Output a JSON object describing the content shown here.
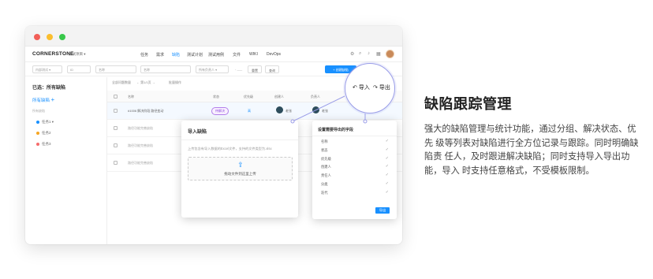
{
  "window": {
    "traffic_lights": [
      "#f25f58",
      "#fbbe2e",
      "#38c84a"
    ]
  },
  "topnav": {
    "brand": "CORNERSTONE",
    "project": "测试项目 ▾",
    "items": [
      {
        "label": "任务",
        "active": false
      },
      {
        "label": "需求",
        "active": false
      },
      {
        "label": "缺陷",
        "active": true
      },
      {
        "label": "测试计划",
        "active": false
      },
      {
        "label": "测试用例",
        "active": false
      },
      {
        "label": "文件",
        "active": false
      },
      {
        "label": "WIKI",
        "active": false
      },
      {
        "label": "DevOps",
        "active": false
      }
    ],
    "icons": [
      "settings-icon",
      "search-icon",
      "bell-icon",
      "grid-icon"
    ]
  },
  "filters": {
    "select1": "内部测试 ▾",
    "input1": "ID",
    "input2": "名称",
    "input3": "名称",
    "select2": "所有负责人 ▾",
    "date": "- ___",
    "reset": "重置",
    "search": "查询",
    "create": "+ 创建缺陷"
  },
  "sidebar": {
    "title": "已选：所有缺陷",
    "link": "所有缺陷",
    "subtitle": "所有缺陷",
    "items": [
      {
        "label": "任务1",
        "color": "#1890ff"
      },
      {
        "label": "任务2",
        "color": "#f5a623"
      },
      {
        "label": "任务3",
        "color": "#f56c6c"
      }
    ]
  },
  "main": {
    "tab_left": "全部问题数量",
    "tab_mid": "← 第1/1页 →",
    "tab_right": "批量操作",
    "columns": [
      "名称",
      "状态",
      "优先级",
      "创建人",
      "负责人"
    ],
    "rows": [
      {
        "name": "#1006 解决阶段 路径变动",
        "status": "待解决",
        "priority": "高",
        "creator": "老张",
        "owner": "老张"
      },
      {
        "name": "路径功能完善缺陷",
        "status": "",
        "priority": "",
        "creator": "",
        "owner": ""
      },
      {
        "name": "路径功能完善缺陷",
        "status": "",
        "priority": "",
        "creator": "",
        "owner": ""
      },
      {
        "name": "路径功能完善缺陷",
        "status": "",
        "priority": "",
        "creator": "",
        "owner": ""
      }
    ]
  },
  "import_modal": {
    "title": "导入缺陷",
    "hint": "上传包含有导入数据的Excel文件，支持的文件类型为.xlsx",
    "upload": "拖动文件到这里上传"
  },
  "export_modal": {
    "title": "设置需要导出的字段",
    "fields": [
      "名称",
      "状态",
      "优先级",
      "创建人",
      "责任人",
      "分类",
      "迭代"
    ],
    "button": "导出"
  },
  "callout": {
    "import": "导入",
    "export": "导出"
  },
  "content": {
    "heading": "缺陷跟踪管理",
    "description": "强大的缺陷管理与统计功能，通过分组、解决状态、优先 级等列表对缺陷进行全方位记录与跟踪。同时明确缺陷责 任人，及时跟进解决缺陷；同时支持导入导出功能，导入 时支持任意格式，不受模板限制。"
  },
  "colors": {
    "accent": "#1890ff",
    "callout_border": "#9a9de8",
    "status_tag": "#b37feb"
  }
}
